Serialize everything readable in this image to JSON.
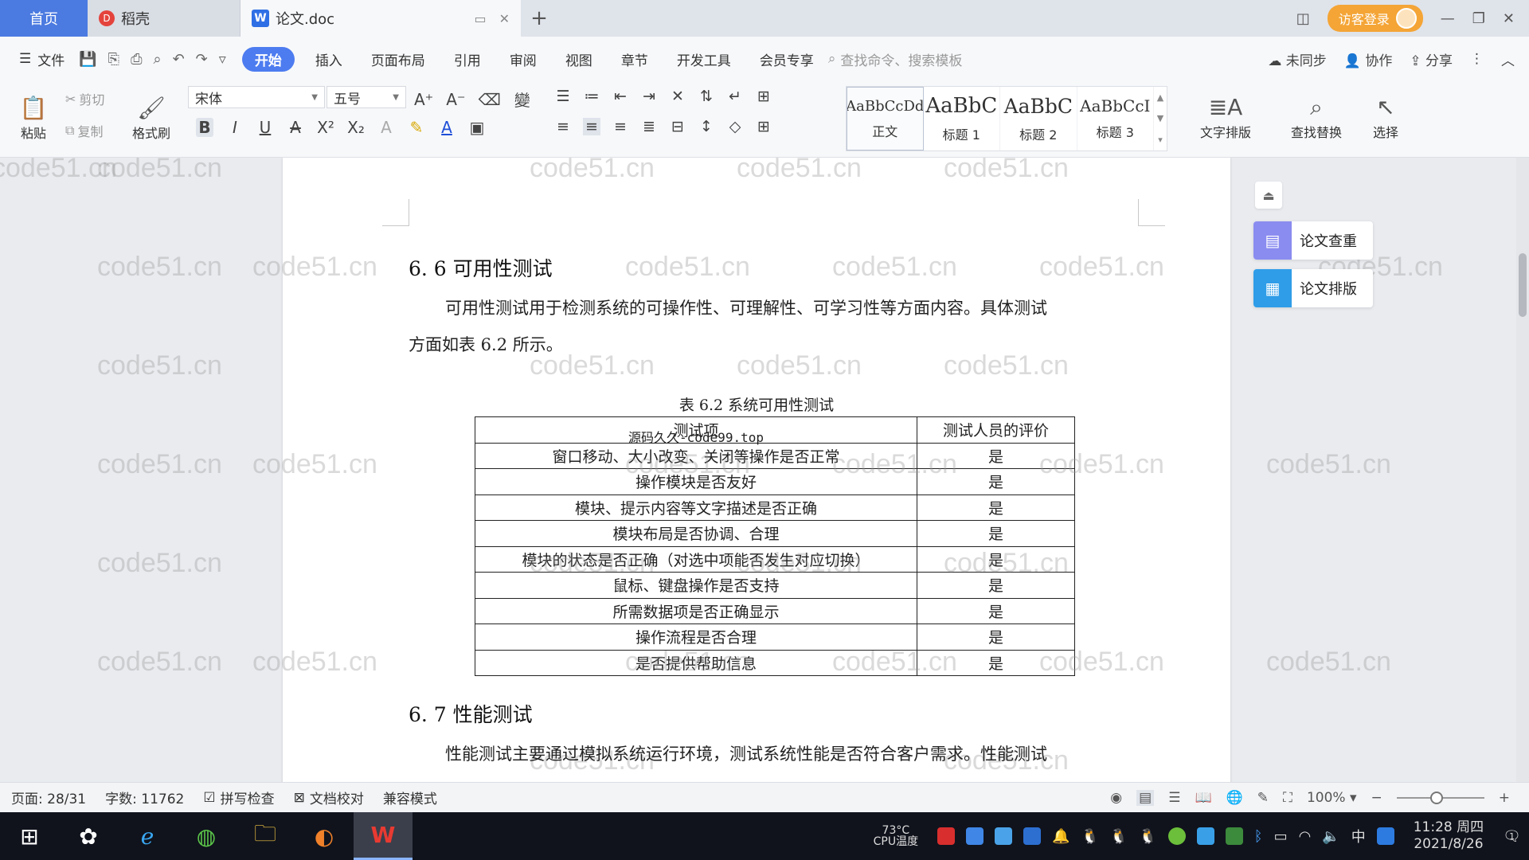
{
  "titlebar": {
    "tabs": [
      {
        "label": "首页",
        "icon": "home-tab"
      },
      {
        "label": "稻壳",
        "icon": "docer-icon"
      },
      {
        "label": "论文.doc",
        "icon": "word-doc-icon"
      }
    ],
    "guest_login": "访客登录"
  },
  "menubar": {
    "file": "文件",
    "items": [
      "开始",
      "插入",
      "页面布局",
      "引用",
      "审阅",
      "视图",
      "章节",
      "开发工具",
      "会员专享"
    ],
    "search_placeholder": "查找命令、搜索模板",
    "unsynced": "未同步",
    "collaborate": "协作",
    "share": "分享"
  },
  "ribbon": {
    "paste": "粘贴",
    "cut": "剪切",
    "copy": "复制",
    "format_painter": "格式刷",
    "font_name": "宋体",
    "font_size": "五号",
    "styles": [
      {
        "preview": "AaBbCcDd",
        "label": "正文"
      },
      {
        "preview": "AaBbC",
        "label": "标题 1"
      },
      {
        "preview": "AaBbC",
        "label": "标题 2"
      },
      {
        "preview": "AaBbCcI",
        "label": "标题 3"
      }
    ],
    "text_layout": "文字排版",
    "find_replace": "查找替换",
    "select": "选择"
  },
  "document": {
    "section_66": "6. 6 可用性测试",
    "para_66_line1": "可用性测试用于检测系统的可操作性、可理解性、可学习性等方面内容。具体测试",
    "para_66_line2": "方面如表 6.2 所示。",
    "table_caption": "表 6.2  系统可用性测试",
    "table_headers": [
      "测试项",
      "测试人员的评价"
    ],
    "overlay_text": "源码久久-code99.top",
    "table_rows": [
      [
        "窗口移动、大小改变、关闭等操作是否正常",
        "是"
      ],
      [
        "操作模块是否友好",
        "是"
      ],
      [
        "模块、提示内容等文字描述是否正确",
        "是"
      ],
      [
        "模块布局是否协调、合理",
        "是"
      ],
      [
        "模块的状态是否正确（对选中项能否发生对应切换）",
        "是"
      ],
      [
        "鼠标、键盘操作是否支持",
        "是"
      ],
      [
        "所需数据项是否正确显示",
        "是"
      ],
      [
        "操作流程是否合理",
        "是"
      ],
      [
        "是否提供帮助信息",
        "是"
      ]
    ],
    "section_67": "6. 7 性能测试",
    "para_67_line1": "性能测试主要通过模拟系统运行环境，测试系统性能是否符合客户需求。性能测试",
    "watermark": "code51.cn"
  },
  "side_panel": {
    "paper_check": "论文查重",
    "paper_layout": "论文排版"
  },
  "statusbar": {
    "page": "页面: 28/31",
    "words": "字数: 11762",
    "spell_check": "拼写检查",
    "doc_proof": "文档校对",
    "compat_mode": "兼容模式",
    "zoom": "100%",
    "zoom_level": 0.5
  },
  "taskbar": {
    "temperature": "73°C",
    "cpu_temp_label": "CPU温度",
    "ime": "中",
    "time": "11:28 周四",
    "date": "2021/8/26",
    "notification_count": "1"
  }
}
